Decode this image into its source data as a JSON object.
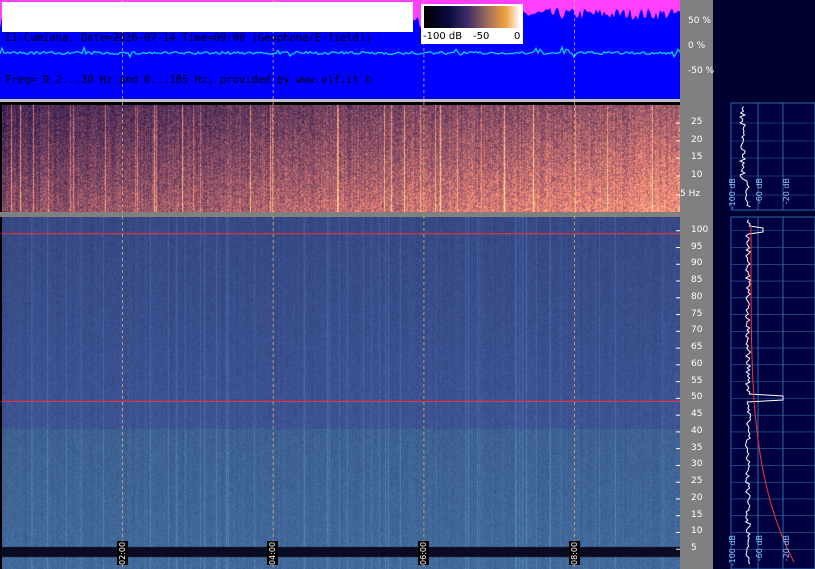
{
  "header": {
    "line1": "I1-Cumiana, Date=2026-07-14 Time=09:00 (Geophone/E-field))",
    "line2": "Freq= 0.2...30 Hz and 0...105 Hz, provided by www.vlf.it ©"
  },
  "colorbar": {
    "ticks": [
      "-100 dB",
      "-50",
      "0"
    ],
    "colors": [
      "#000000",
      "#0a0a3a",
      "#3a2a6a",
      "#9a6a5a",
      "#f0a040",
      "#ffffff"
    ]
  },
  "chart_data": [
    {
      "type": "line",
      "name": "waveform",
      "yticks": [
        "50 %",
        "0 %",
        "-50 %"
      ],
      "ylim": [
        -100,
        100
      ],
      "xlim_hours": [
        0,
        9
      ],
      "colors": {
        "background": "#0000ff",
        "upper_envelope": "#ff40ff",
        "trace": "#00e0ff"
      }
    },
    {
      "type": "heatmap",
      "name": "low-frequency spectrogram",
      "yticks": [
        "25",
        "20",
        "15",
        "10",
        "5 Hz"
      ],
      "ylim": [
        0.2,
        30
      ],
      "xlim_hours": [
        0,
        9
      ],
      "profile_ticks": [
        "-100 dB",
        "-60 dB",
        "-20 dB"
      ]
    },
    {
      "type": "heatmap",
      "name": "spectrogram 0-105 Hz",
      "yticks": [
        "100",
        "95",
        "90",
        "85",
        "80",
        "75",
        "70",
        "65",
        "60",
        "55",
        "50",
        "45",
        "40",
        "35",
        "30",
        "25",
        "20",
        "15",
        "10",
        "5"
      ],
      "ylim": [
        0,
        105
      ],
      "xlim_hours": [
        0,
        9
      ],
      "x_tick_labels": [
        "02:00",
        "04:00",
        "06:00",
        "08:00"
      ],
      "profile_ticks": [
        "-100 dB",
        "-60 dB",
        "-20 dB"
      ],
      "lines_hz": [
        50,
        100
      ]
    }
  ],
  "time_labels": [
    "02:00",
    "04:00",
    "06:00",
    "08:00"
  ]
}
